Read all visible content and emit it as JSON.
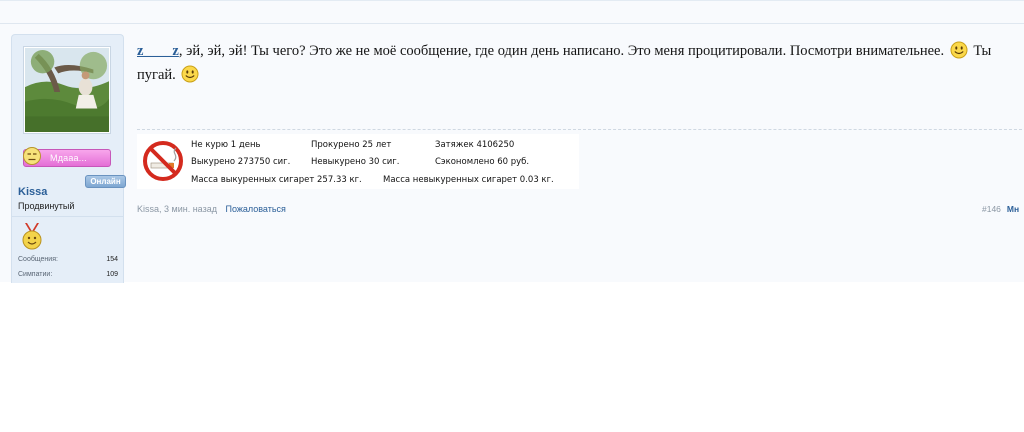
{
  "user": {
    "name": "Kissa",
    "title": "Продвинутый",
    "mood_label": "Мдааа...",
    "online_label": "Онлайн",
    "stats": [
      {
        "label": "Сообщения:",
        "value": "154"
      },
      {
        "label": "Симпатии:",
        "value": "109"
      }
    ]
  },
  "post": {
    "quoted_user": "z____z",
    "text_before_smile": ", эй, эй, эй! Ты чего? Это же не моё сообщение, где один день написано. Это меня процитировали. Посмотри внимательнее.",
    "text_after_smile": "Ты",
    "text_line2": "пугай.",
    "smile_icon": "smiley-icon"
  },
  "signature": {
    "icon": "no-smoking-icon",
    "not_smoking": "Не курю 1 день",
    "smoked_years": "Прокурено 25 лет",
    "puffs": "Затяжек 4106250",
    "smoked_cigs": "Выкурено 273750 сиг.",
    "not_smoked_cigs": "Невыкурено 30 сиг.",
    "saved": "Сэкономлено 60 руб.",
    "mass_smoked": "Масса выкуренных сигарет 257.33 кг.",
    "mass_not_smoked": "Масса невыкуренных сигарет 0.03 кг."
  },
  "footer": {
    "author": "Kissa",
    "time": ", 3 мин. назад",
    "report": "Пожаловаться",
    "post_number": "#146",
    "more_link": "Мн"
  }
}
